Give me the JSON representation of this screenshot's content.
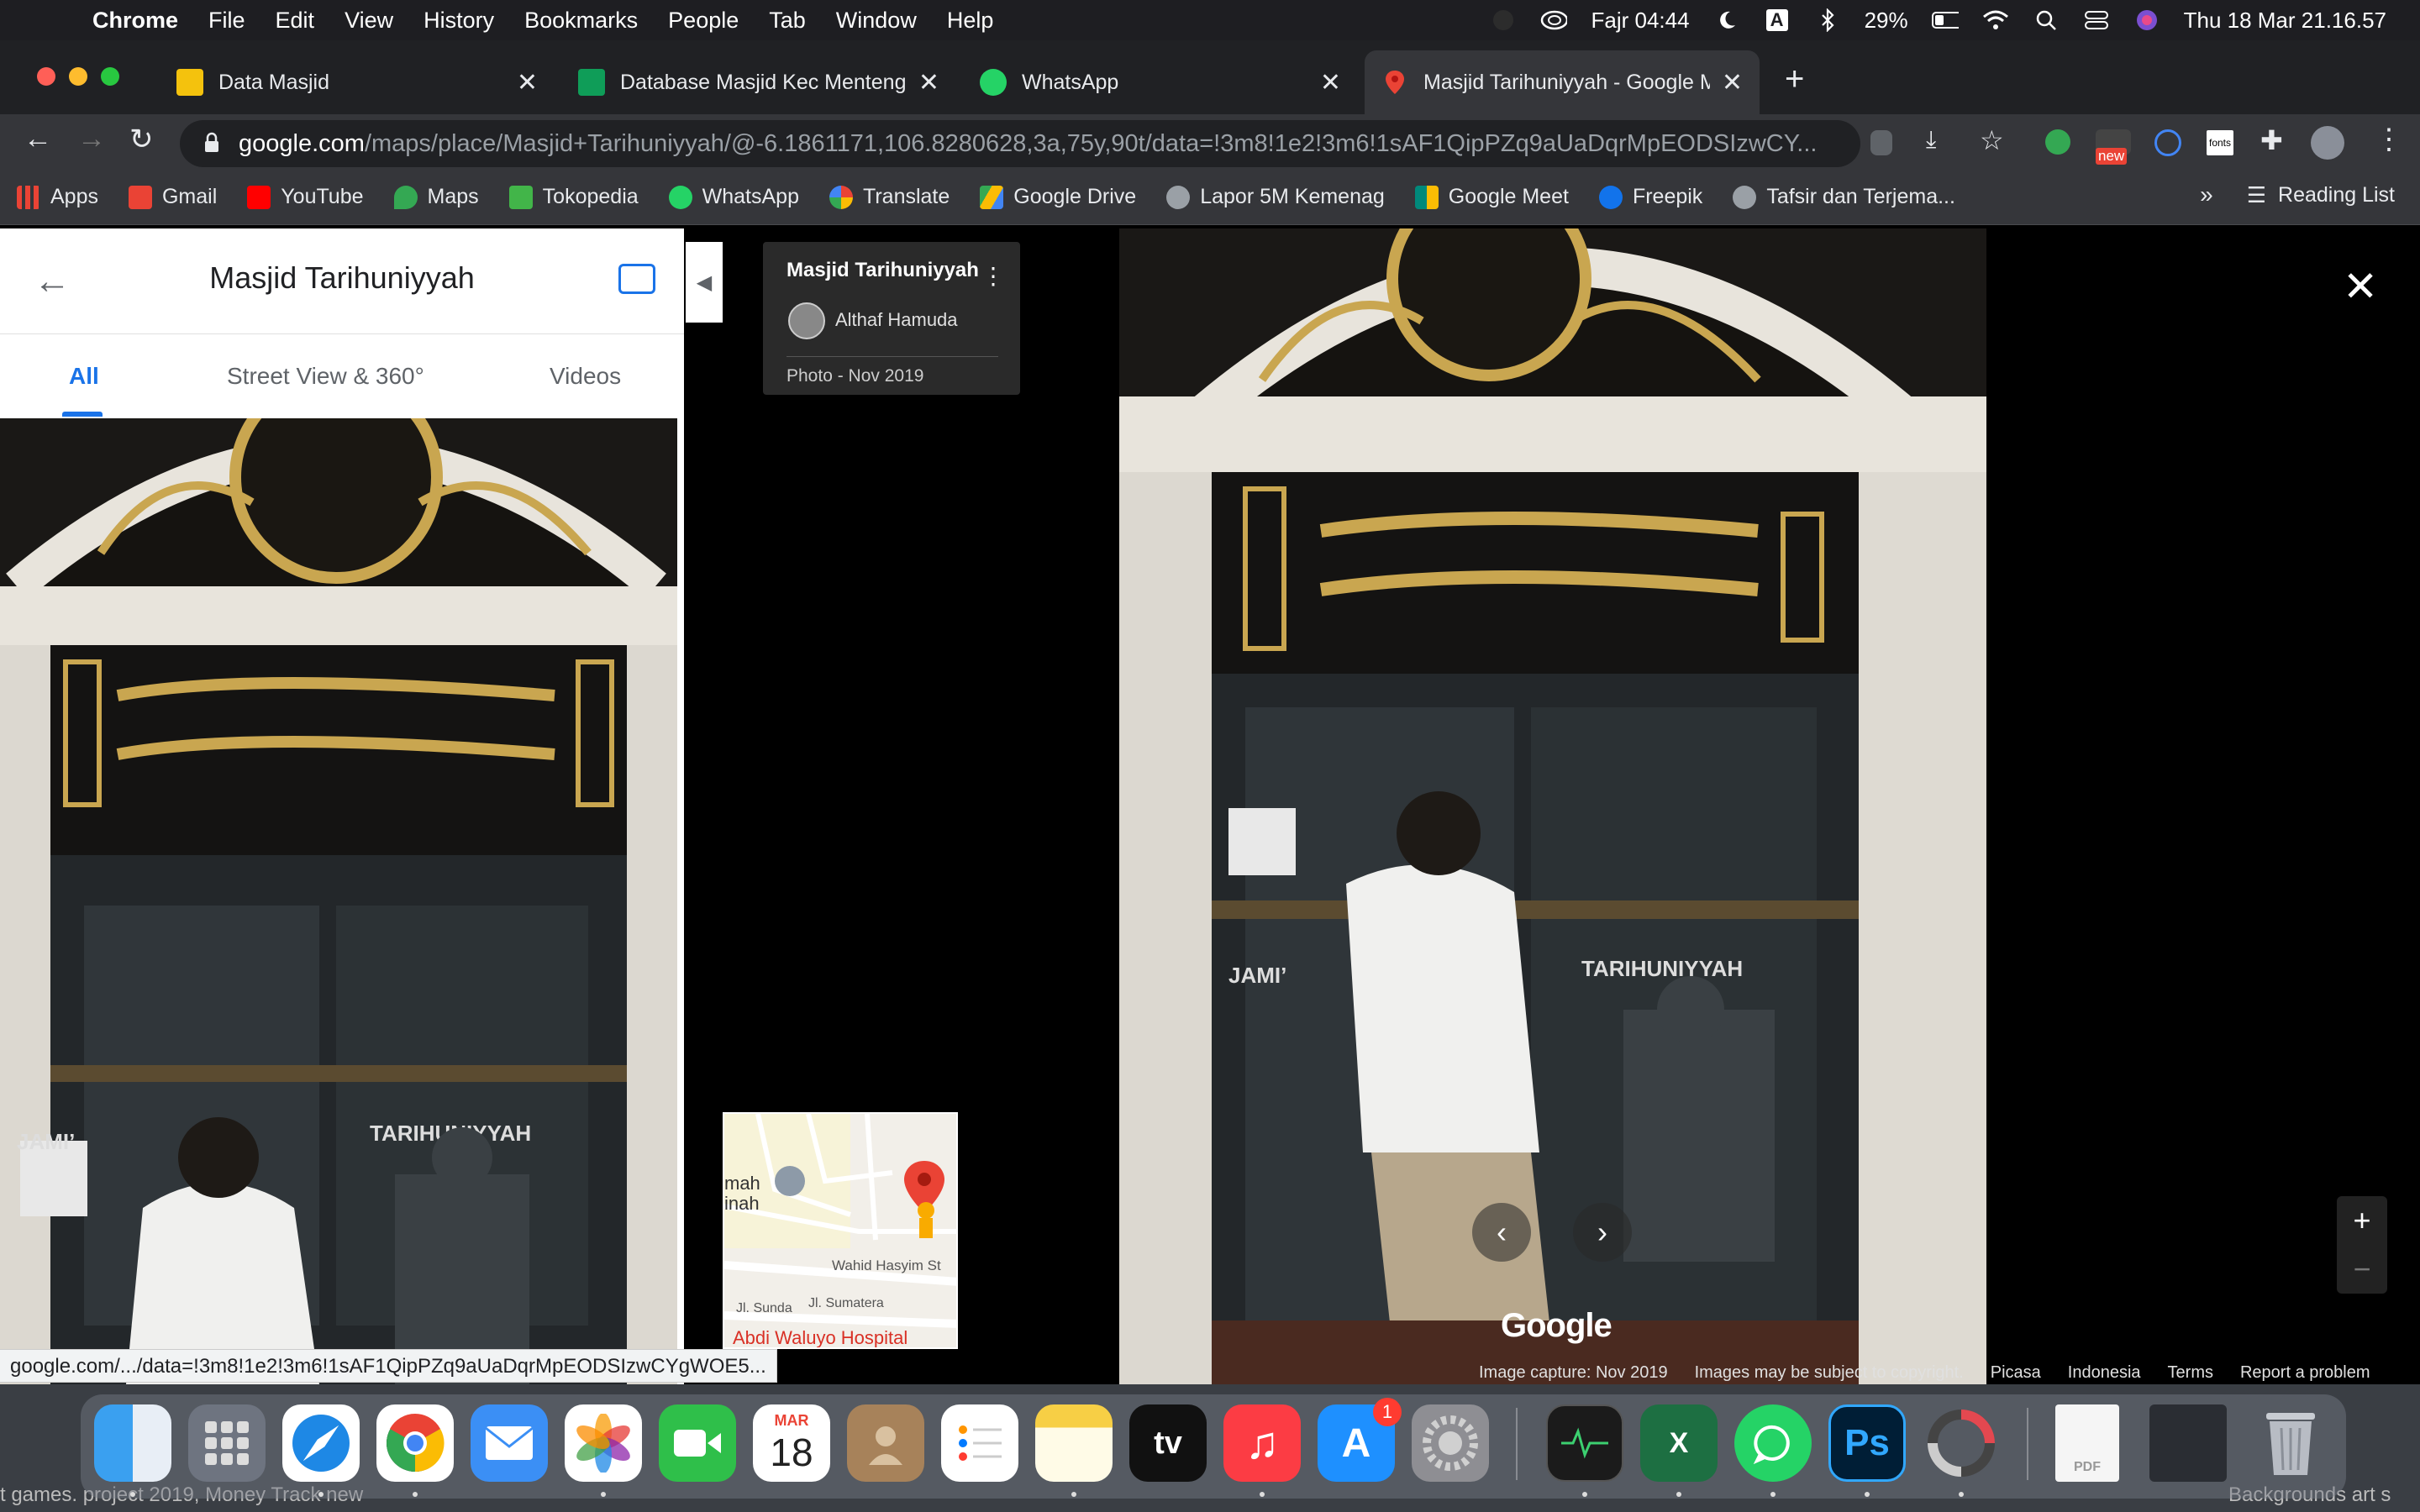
{
  "menubar": {
    "app": "Chrome",
    "items": [
      "File",
      "Edit",
      "View",
      "History",
      "Bookmarks",
      "People",
      "Tab",
      "Window",
      "Help"
    ],
    "prayer": "Fajr 04:44",
    "input_source": "A",
    "battery": "29%",
    "datetime": "Thu 18 Mar  21.16.57"
  },
  "tabs": [
    {
      "title": "Data Masjid",
      "favicon_color": "#f4c20d"
    },
    {
      "title": "Database Masjid Kec Menteng",
      "favicon_color": "#0f9d58"
    },
    {
      "title": "WhatsApp",
      "favicon_color": "#25d366"
    },
    {
      "title": "Masjid Tarihuniyyah - Google M",
      "favicon_color": "#ea4335"
    }
  ],
  "address": {
    "host": "google.com",
    "path": "/maps/place/Masjid+Tarihuniyyah/@-6.1861171,106.8280628,3a,75y,90t/data=!3m8!1e2!3m6!1sAF1QipPZq9aUaDqrMpEODSIzwCY..."
  },
  "extension_new_badge": "new",
  "extension_fonts_label": "fonts",
  "bookmarks": [
    {
      "label": "Apps",
      "icon": "apps-grid-icon",
      "color": "#ea4335"
    },
    {
      "label": "Gmail",
      "icon": "gmail-icon",
      "color": "#ea4335"
    },
    {
      "label": "YouTube",
      "icon": "youtube-icon",
      "color": "#ff0000"
    },
    {
      "label": "Maps",
      "icon": "maps-icon",
      "color": "#34a853"
    },
    {
      "label": "Tokopedia",
      "icon": "tokopedia-icon",
      "color": "#42b549"
    },
    {
      "label": "WhatsApp",
      "icon": "whatsapp-icon",
      "color": "#25d366"
    },
    {
      "label": "Translate",
      "icon": "google-icon",
      "color": "#4285f4"
    },
    {
      "label": "Google Drive",
      "icon": "drive-icon",
      "color": "#fbbc04"
    },
    {
      "label": "Lapor 5M Kemenag",
      "icon": "globe-icon",
      "color": "#9aa0a6"
    },
    {
      "label": "Google Meet",
      "icon": "meet-icon",
      "color": "#00897b"
    },
    {
      "label": "Freepik",
      "icon": "freepik-icon",
      "color": "#1273eb"
    },
    {
      "label": "Tafsir dan Terjema...",
      "icon": "globe-icon",
      "color": "#9aa0a6"
    }
  ],
  "bookmarks_overflow": "»",
  "reading_list": "Reading List",
  "sidepanel": {
    "title": "Masjid Tarihuniyyah",
    "tabs": [
      "All",
      "Street View & 360°",
      "Videos"
    ]
  },
  "photo_texts": {
    "jami": "JAMI’",
    "name": "TARIHUNIYYAH"
  },
  "infocard": {
    "name": "Masjid Tarihuniyyah",
    "author": "Althaf Hamuda",
    "date": "Photo - Nov 2019"
  },
  "minimap": {
    "labels": [
      "mah",
      "inah",
      "Wahid Hasyim St",
      "Jl. Sunda",
      "Jl. Sumatera",
      "Abdi Waluyo Hospital"
    ]
  },
  "viewer": {
    "watermark": "Google",
    "zoom_in": "+",
    "zoom_out": "−",
    "attribution": [
      "Image capture: Nov 2019",
      "Images may be subject to copyright.",
      "Picasa",
      "Indonesia",
      "Terms",
      "Report a problem"
    ]
  },
  "status_url": "google.com/.../data=!3m8!1e2!3m6!1sAF1QipPZq9aUaDqrMpEODSIzwCYgWOE5...",
  "dock": {
    "calendar_month": "MAR",
    "calendar_day": "18",
    "appstore_badge": "1",
    "tv_label": "tv",
    "excel_label": "X",
    "ps_label": "Ps",
    "pdf_label": "PDF"
  },
  "background_text_left": "t games. project 2019, Money Track new",
  "background_text_right": "Backgrounds art s"
}
